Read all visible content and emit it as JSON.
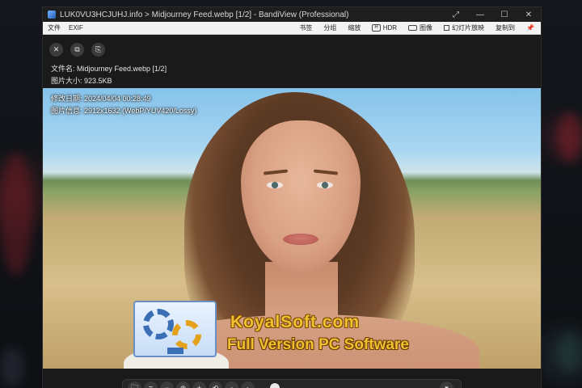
{
  "window": {
    "title": "LUK0VU3HCJUHJ.info > Midjourney Feed.webp [1/2] - BandiView (Professional)",
    "controls": {
      "fullscreen": "⤢",
      "minimize": "—",
      "maximize": "☐",
      "close": "✕"
    }
  },
  "menubar": {
    "left": [
      "文件",
      "EXIF"
    ],
    "right": [
      "书签",
      "分组",
      "缩放",
      "HDR",
      "图像",
      "幻灯片放映",
      "复制到"
    ],
    "pin": "📌"
  },
  "info_buttons": {
    "close": "✕",
    "copy": "⧉",
    "clipboard": "⎘"
  },
  "file_info": {
    "name": "文件名: Midjourney Feed.webp [1/2]",
    "size": "图片大小: 923.5KB",
    "modified": "修改日期: 2024/04/04 00:28:49",
    "details": "图片信息: 2912x1632 (WebP/YUV420/Lossy)"
  },
  "watermark": {
    "line1": "KoyalSoft.com",
    "line2": "Full Version PC Software"
  },
  "colors": {
    "accent_gold": "#f0c030",
    "window_bg": "#1a1a1a",
    "menubar_bg": "#f3f3f3"
  },
  "toolbar": {
    "icons": [
      "folder-icon",
      "menu-icon",
      "zoom-out-icon",
      "zoom-fit-icon",
      "zoom-in-icon",
      "rotate-icon",
      "prev-icon",
      "next-icon"
    ],
    "glyphs": [
      "🗀",
      "≡",
      "−",
      "⊕",
      "+",
      "⟲",
      "‹",
      "›"
    ],
    "dropdown": "▾"
  }
}
